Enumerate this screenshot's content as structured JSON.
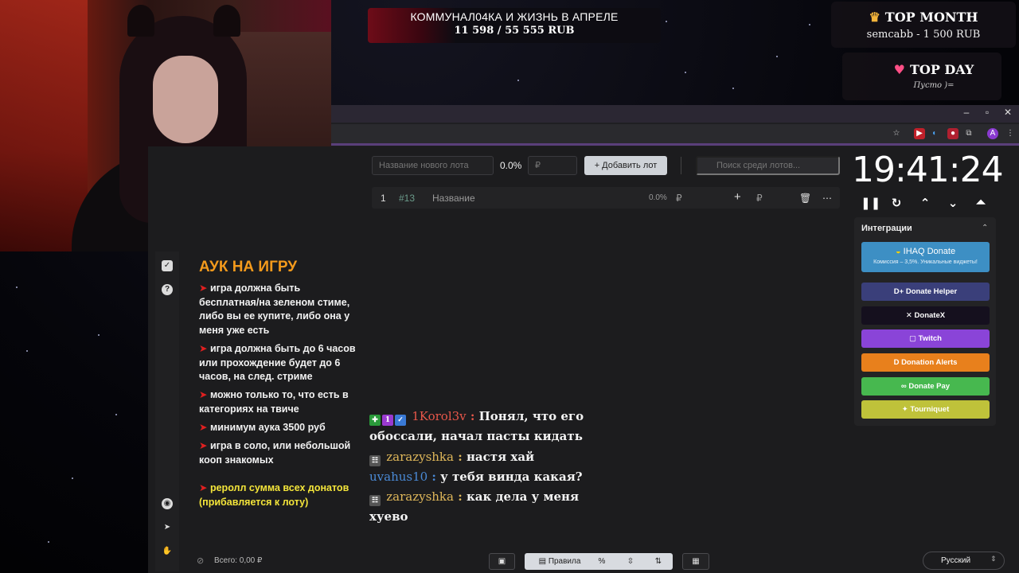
{
  "overlay": {
    "goal_title": "КОММУНАЛ04КА И ЖИЗНЬ В АПРЕЛЕ",
    "goal_amount": "11 598 / 55 555 RUB",
    "top_month": {
      "title": "TOP MONTH",
      "value": "semcabb - 1 500 RUB"
    },
    "top_day": {
      "title": "TOP DAY",
      "value": "Пусто )="
    }
  },
  "auction": {
    "new_lot_placeholder": "Название нового лота",
    "percent": "0.0%",
    "amount_placeholder": "₽",
    "add_button": "Добавить лот",
    "search_placeholder": "Поиск среди лотов...",
    "lots": [
      {
        "index": "1",
        "id": "#13",
        "name": "Название",
        "percent": "0.0%",
        "currency": "₽"
      }
    ]
  },
  "timer": {
    "value": "19:41:24"
  },
  "integrations": {
    "title": "Интеграции",
    "ihaq_title": "IHAQ Donate",
    "ihaq_subtitle": "Комиссия – 3,5%. Уникальные виджеты!",
    "buttons": [
      {
        "label": "Donate Helper",
        "color": "#3a3f7a"
      },
      {
        "label": "DonateX",
        "color": "#15101e"
      },
      {
        "label": "Twitch",
        "color": "#8a44d8"
      },
      {
        "label": "Donation Alerts",
        "color": "#e8801c"
      },
      {
        "label": "Donate Pay",
        "color": "#47b84f"
      },
      {
        "label": "Tourniquet",
        "color": "#bfc23a"
      }
    ]
  },
  "rules": {
    "title": "АУК НА ИГРУ",
    "items": [
      "игра должна быть бесплатная/на зеленом стиме, либо вы ее купите, либо она у меня уже есть",
      "игра должна быть до 6 часов или прохождение будет до 6 часов, на след. стриме",
      "можно только то, что есть в категориях на твиче",
      "минимум аука 3500 руб",
      "игра в соло, или небольшой кооп знакомых"
    ],
    "highlight": "реролл сумма всех донатов (прибавляется к лоту)"
  },
  "chat": [
    {
      "user": "1Korol3v",
      "user_color": "#e8574a",
      "message": "Понял, что его обоссали, начал пасты кидать"
    },
    {
      "user": "zarazyshka",
      "user_color": "#e0b85a",
      "message": "настя хай"
    },
    {
      "user": "uvahus10",
      "user_color": "#4a8ad6",
      "message": "у тебя винда какая?"
    },
    {
      "user": "zarazyshka",
      "user_color": "#e0b85a",
      "message": "как дела у меня хуево"
    }
  ],
  "bottom": {
    "total": "Всего: 0,00 ₽",
    "rules_button": "Правила",
    "language": "Русский"
  },
  "colors": {
    "accent_orange": "#f39a1c",
    "arrow_red": "#e02020",
    "highlight_yellow": "#f4e53a"
  }
}
